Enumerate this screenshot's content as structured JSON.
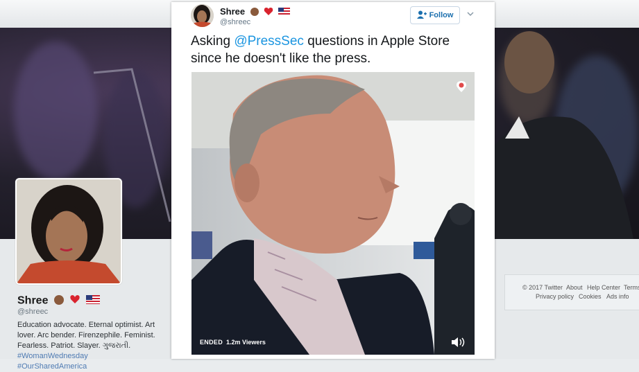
{
  "tweet": {
    "author_name": "Shree",
    "author_handle": "@shreec",
    "follow_label": "Follow",
    "text_before": "Asking ",
    "mention": "@PressSec",
    "text_after": " questions in Apple Store since he doesn't like the press."
  },
  "video": {
    "status": "ENDED",
    "viewers": "1.2m Viewers",
    "icons": [
      "periscope-icon",
      "volume-icon"
    ]
  },
  "profile": {
    "name": "Shree",
    "handle": "@shreec",
    "bio": "Education advocate. Eternal optimist. Art lover. Arc bender. Firenzephile. Feminist. Fearless. Patriot. Slayer. ગુજરાતી.",
    "bio_tags": "#WomanWednesday #OurSharedAmerica"
  },
  "footer": {
    "copyright": "© 2017 Twitter",
    "about": "About",
    "help": "Help Center",
    "terms": "Terms",
    "privacy": "Privacy policy",
    "cookies": "Cookies",
    "ads": "Ads info"
  },
  "colors": {
    "link": "#1b95e0",
    "follow_text": "#1b6fae"
  }
}
